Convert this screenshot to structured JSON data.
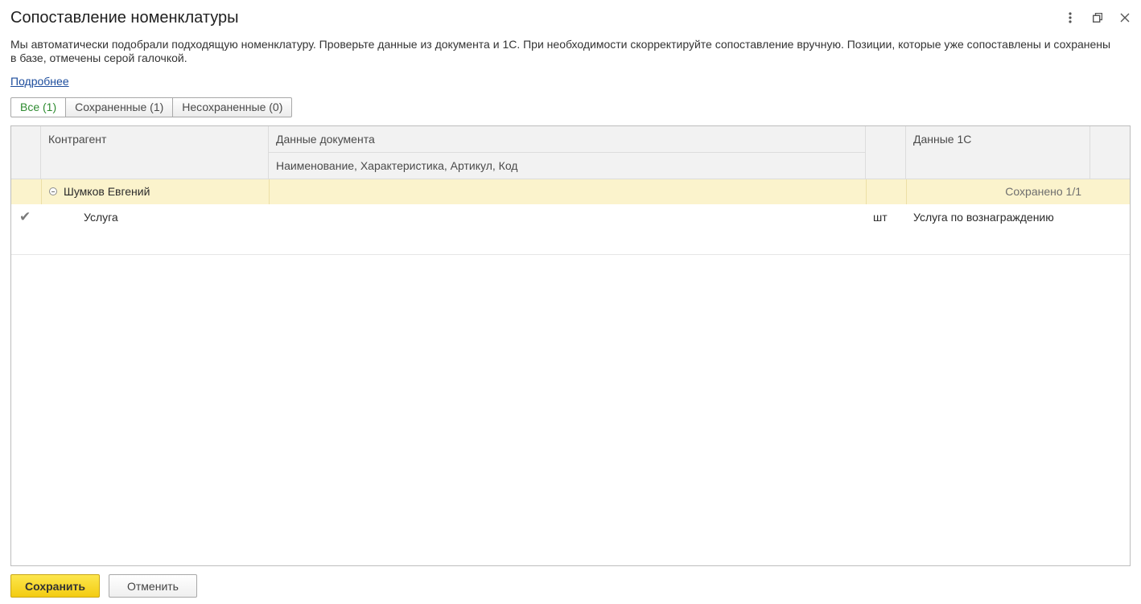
{
  "window": {
    "title": "Сопоставление номенклатуры",
    "menu_icon": "more-vertical-icon",
    "restore_icon": "restore-window-icon",
    "close_icon": "close-icon"
  },
  "description": "Мы автоматически подобрали подходящую номенклатуру. Проверьте данные из документа и 1С. При необходимости скорректируйте сопоставление вручную. Позиции, которые уже сопоставлены и сохранены в базе, отмечены серой галочкой.",
  "more_link": "Подробнее",
  "tabs": [
    {
      "label": "Все (1)",
      "active": true
    },
    {
      "label": "Сохраненные (1)",
      "active": false
    },
    {
      "label": "Несохраненные (0)",
      "active": false
    }
  ],
  "table": {
    "headers": {
      "counterparty": "Контрагент",
      "document_data": "Данные документа",
      "document_subheader": "Наименование, Характеристика, Артикул, Код",
      "data_1c": "Данные 1С"
    },
    "group": {
      "name": "Шумков Евгений",
      "status": "Сохранено 1/1"
    },
    "rows": [
      {
        "name": "Услуга",
        "unit": "шт",
        "match_1c": "Услуга по вознаграждению",
        "saved": true
      }
    ]
  },
  "buttons": {
    "save": "Сохранить",
    "cancel": "Отменить"
  },
  "colors": {
    "accent_yellow": "#f3cc12",
    "active_tab_text": "#2e8b30",
    "group_row_bg": "#fbf3cc",
    "link": "#1c4c9c"
  }
}
